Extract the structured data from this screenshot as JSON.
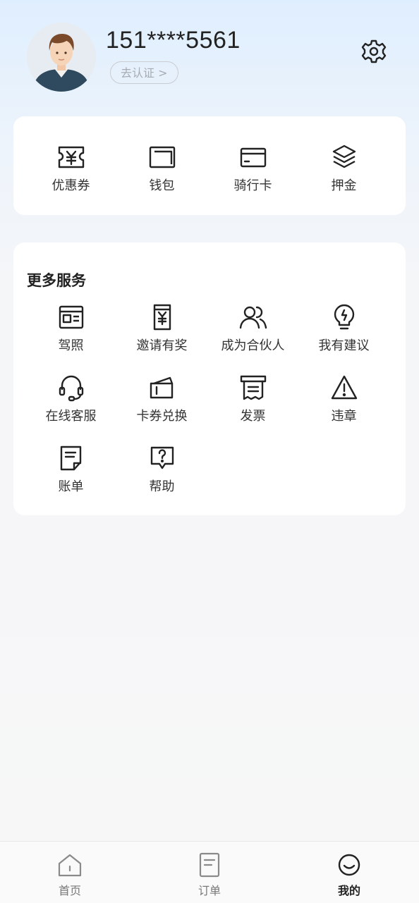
{
  "user": {
    "phone": "151****5561",
    "verify_label": "去认证 >"
  },
  "quick_actions": [
    {
      "label": "优惠券",
      "icon": "coupon-icon"
    },
    {
      "label": "钱包",
      "icon": "wallet-icon"
    },
    {
      "label": "骑行卡",
      "icon": "card-icon"
    },
    {
      "label": "押金",
      "icon": "layers-icon"
    }
  ],
  "more_services": {
    "title": "更多服务",
    "items": [
      {
        "label": "驾照",
        "icon": "license-icon"
      },
      {
        "label": "邀请有奖",
        "icon": "invite-reward-icon"
      },
      {
        "label": "成为合伙人",
        "icon": "partner-icon"
      },
      {
        "label": "我有建议",
        "icon": "lightbulb-icon"
      },
      {
        "label": "在线客服",
        "icon": "headset-icon"
      },
      {
        "label": "卡券兑换",
        "icon": "ticket-icon"
      },
      {
        "label": "发票",
        "icon": "invoice-icon"
      },
      {
        "label": "违章",
        "icon": "warning-icon"
      },
      {
        "label": "账单",
        "icon": "bill-icon"
      },
      {
        "label": "帮助",
        "icon": "help-icon"
      }
    ]
  },
  "tabbar": {
    "tabs": [
      {
        "label": "首页",
        "icon": "home-icon",
        "active": false
      },
      {
        "label": "订单",
        "icon": "order-icon",
        "active": false
      },
      {
        "label": "我的",
        "icon": "profile-icon",
        "active": true
      }
    ]
  },
  "colors": {
    "accent_text": "#222222",
    "inactive_tab": "#777777"
  }
}
